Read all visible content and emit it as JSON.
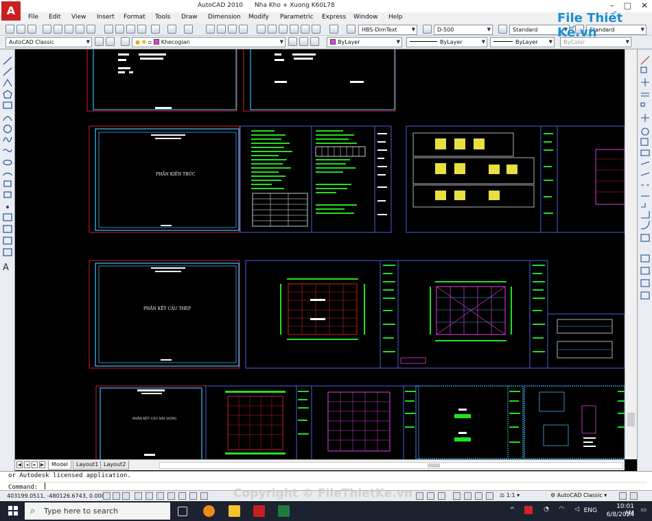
{
  "app": {
    "title": "AutoCAD 2010",
    "document": "Nha Kho + Xuong K60L78",
    "logo_letter": "A",
    "watermark_logo": "File Thiết Kế.vn",
    "watermark_copyright": "Copyright © FileThietKe.vn"
  },
  "menu": [
    "File",
    "Edit",
    "View",
    "Insert",
    "Format",
    "Tools",
    "Draw",
    "Dimension",
    "Modify",
    "Parametric",
    "Express",
    "Window",
    "Help"
  ],
  "toolbar": {
    "dimstyle": "HBS-DimText",
    "scale": "D-500",
    "textstyle": "Standard",
    "tablestyle": "Standard",
    "workspace": "AutoCAD Classic",
    "layer": "Khecogian",
    "color": "ByLayer",
    "linetype": "ByLayer",
    "lineweight": "ByLayer",
    "plotstyle": "ByColor"
  },
  "drawing": {
    "sheet_titles": [
      "PHẦN KIẾN TRÚC",
      "PHẦN KẾT CẤU THÉP",
      "PHẦN KẾT CẤU XÂY DỰNG"
    ]
  },
  "tabs": [
    "Model",
    "Layout1",
    "Layout2"
  ],
  "command": {
    "history": "or Autodesk licensed application.",
    "prompt": "Command:"
  },
  "status": {
    "coords": "403199.0511, -480126.6743, 0.0000",
    "annotation_scale": "1:1",
    "workspace": "AutoCAD Classic"
  },
  "taskbar": {
    "search_placeholder": "Type here to search",
    "language": "ENG",
    "time": "10:01 AM",
    "date": "6/8/2024"
  },
  "colors": {
    "canvas_bg": "#000000",
    "frame_red": "#d0202a",
    "frame_cyan": "#3ab6f5",
    "frame_blue": "#4a5fe0",
    "frame_white": "#ffffff",
    "text_green": "#22e022",
    "magenta": "#e040e0",
    "yellow": "#e8e040",
    "taskbar_bg": "#1d2230"
  }
}
